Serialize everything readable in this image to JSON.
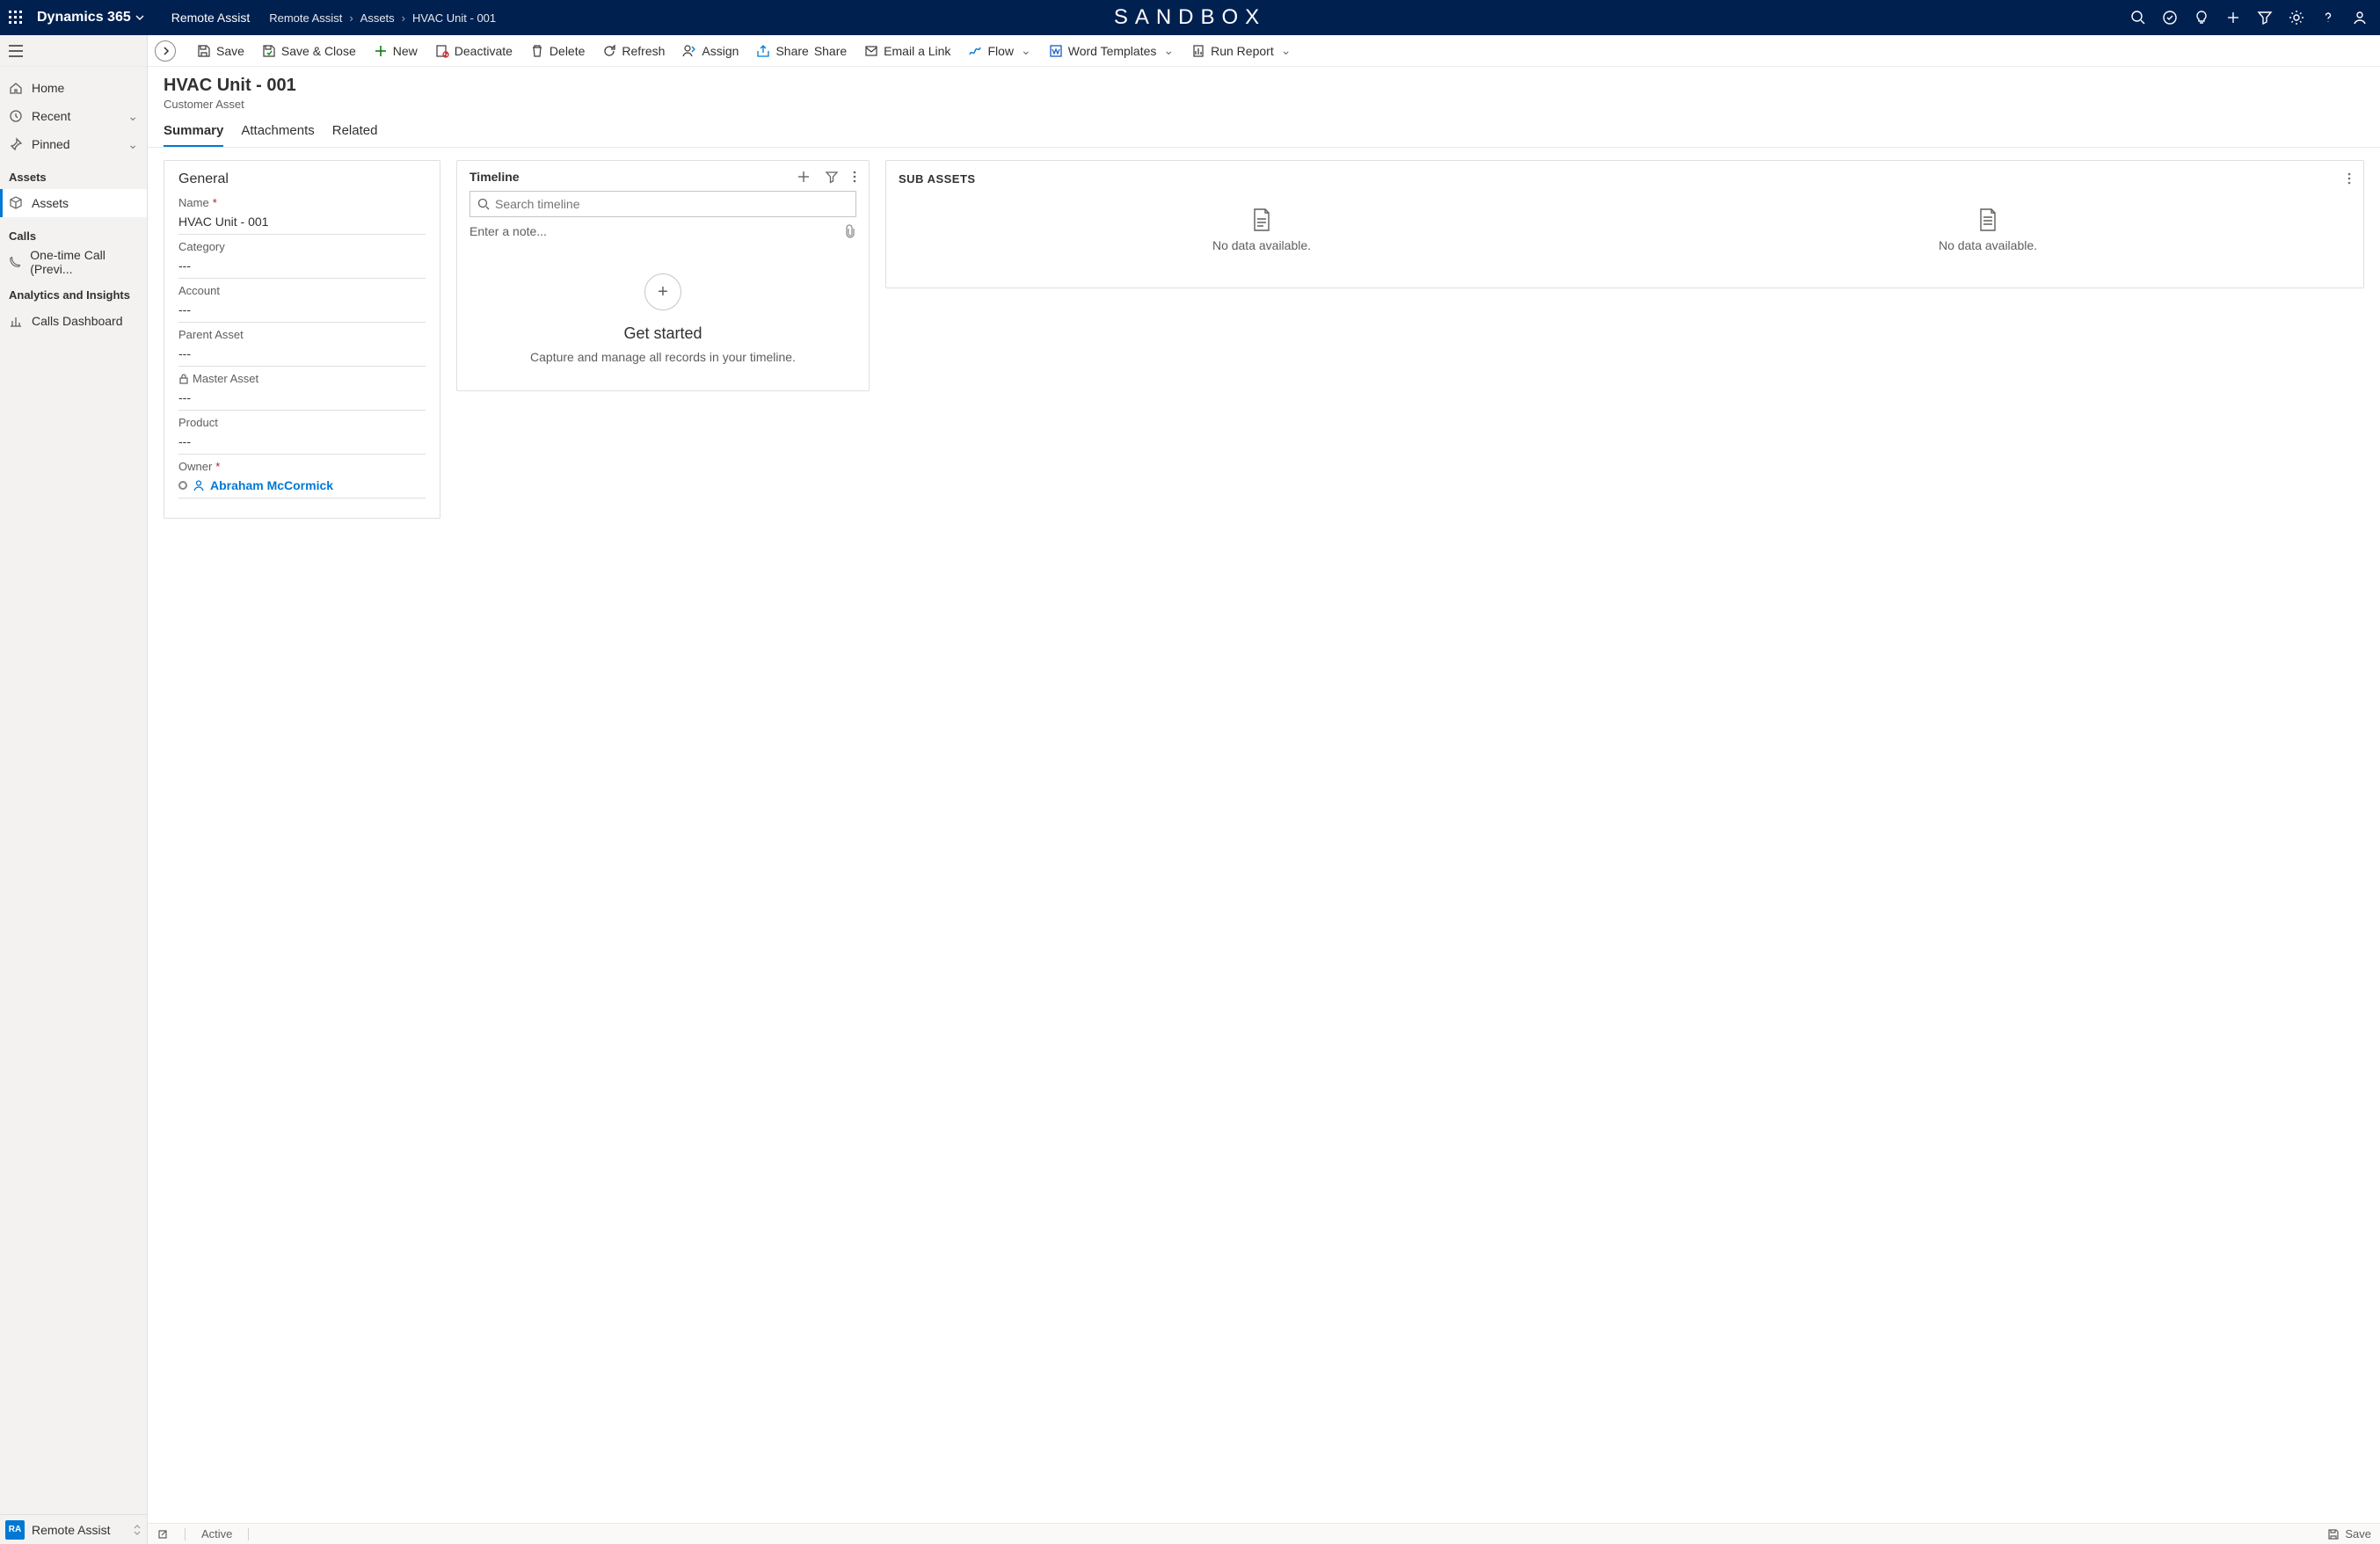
{
  "topbar": {
    "brand": "Dynamics 365",
    "app": "Remote Assist",
    "sandbox": "SANDBOX",
    "breadcrumbs": [
      "Remote Assist",
      "Assets",
      "HVAC Unit - 001"
    ]
  },
  "sidebar": {
    "home": "Home",
    "recent": "Recent",
    "pinned": "Pinned",
    "groups": {
      "assets": {
        "label": "Assets",
        "items": [
          "Assets"
        ]
      },
      "calls": {
        "label": "Calls",
        "items": [
          "One-time Call (Previ..."
        ]
      },
      "analytics": {
        "label": "Analytics and Insights",
        "items": [
          "Calls Dashboard"
        ]
      }
    },
    "bottom": {
      "badge": "RA",
      "label": "Remote Assist"
    }
  },
  "commands": {
    "save": "Save",
    "saveClose": "Save & Close",
    "new": "New",
    "deactivate": "Deactivate",
    "delete": "Delete",
    "refresh": "Refresh",
    "assign": "Assign",
    "share": "Share",
    "emailLink": "Email a Link",
    "flow": "Flow",
    "wordTemplates": "Word Templates",
    "runReport": "Run Report"
  },
  "header": {
    "title": "HVAC Unit - 001",
    "subtitle": "Customer Asset"
  },
  "tabs": {
    "summary": "Summary",
    "attachments": "Attachments",
    "related": "Related"
  },
  "general": {
    "section": "General",
    "name": {
      "label": "Name",
      "value": "HVAC Unit - 001"
    },
    "category": {
      "label": "Category",
      "value": "---"
    },
    "account": {
      "label": "Account",
      "value": "---"
    },
    "parent": {
      "label": "Parent Asset",
      "value": "---"
    },
    "master": {
      "label": "Master Asset",
      "value": "---"
    },
    "product": {
      "label": "Product",
      "value": "---"
    },
    "owner": {
      "label": "Owner",
      "value": "Abraham McCormick"
    }
  },
  "timeline": {
    "title": "Timeline",
    "searchPlaceholder": "Search timeline",
    "notePlaceholder": "Enter a note...",
    "emptyTitle": "Get started",
    "emptyText": "Capture and manage all records in your timeline."
  },
  "subassets": {
    "title": "SUB ASSETS",
    "noData": "No data available."
  },
  "status": {
    "active": "Active",
    "save": "Save"
  }
}
